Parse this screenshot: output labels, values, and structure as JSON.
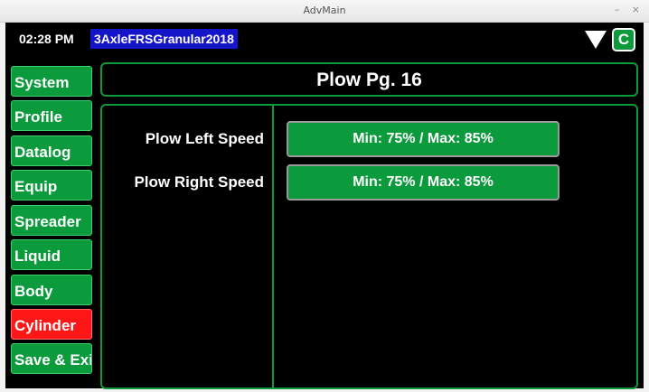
{
  "window": {
    "title": "AdvMain",
    "minimize_glyph": "–",
    "close_glyph": "×"
  },
  "topbar": {
    "time": "02:28 PM",
    "profile_name": "3AxleFRSGranular2018",
    "warning_icon": "down-triangle-icon",
    "c_button_label": "C"
  },
  "nav": {
    "items": [
      {
        "label": "System"
      },
      {
        "label": "Profile"
      },
      {
        "label": "Datalog"
      },
      {
        "label": "Equip"
      },
      {
        "label": "Spreader"
      },
      {
        "label": "Liquid"
      },
      {
        "label": "Body"
      },
      {
        "label": "Cylinder",
        "active": true
      },
      {
        "label": "Save & Exit"
      }
    ]
  },
  "page": {
    "title": "Plow Pg. 16",
    "rows": [
      {
        "label": "Plow Left Speed",
        "value": "Min: 75% / Max: 85%"
      },
      {
        "label": "Plow Right Speed",
        "value": "Min: 75% / Max: 85%"
      }
    ]
  },
  "colors": {
    "accent_green": "#0b9a3c",
    "active_red": "#ff1616",
    "profile_blue": "#1414c8",
    "background": "#000000"
  }
}
